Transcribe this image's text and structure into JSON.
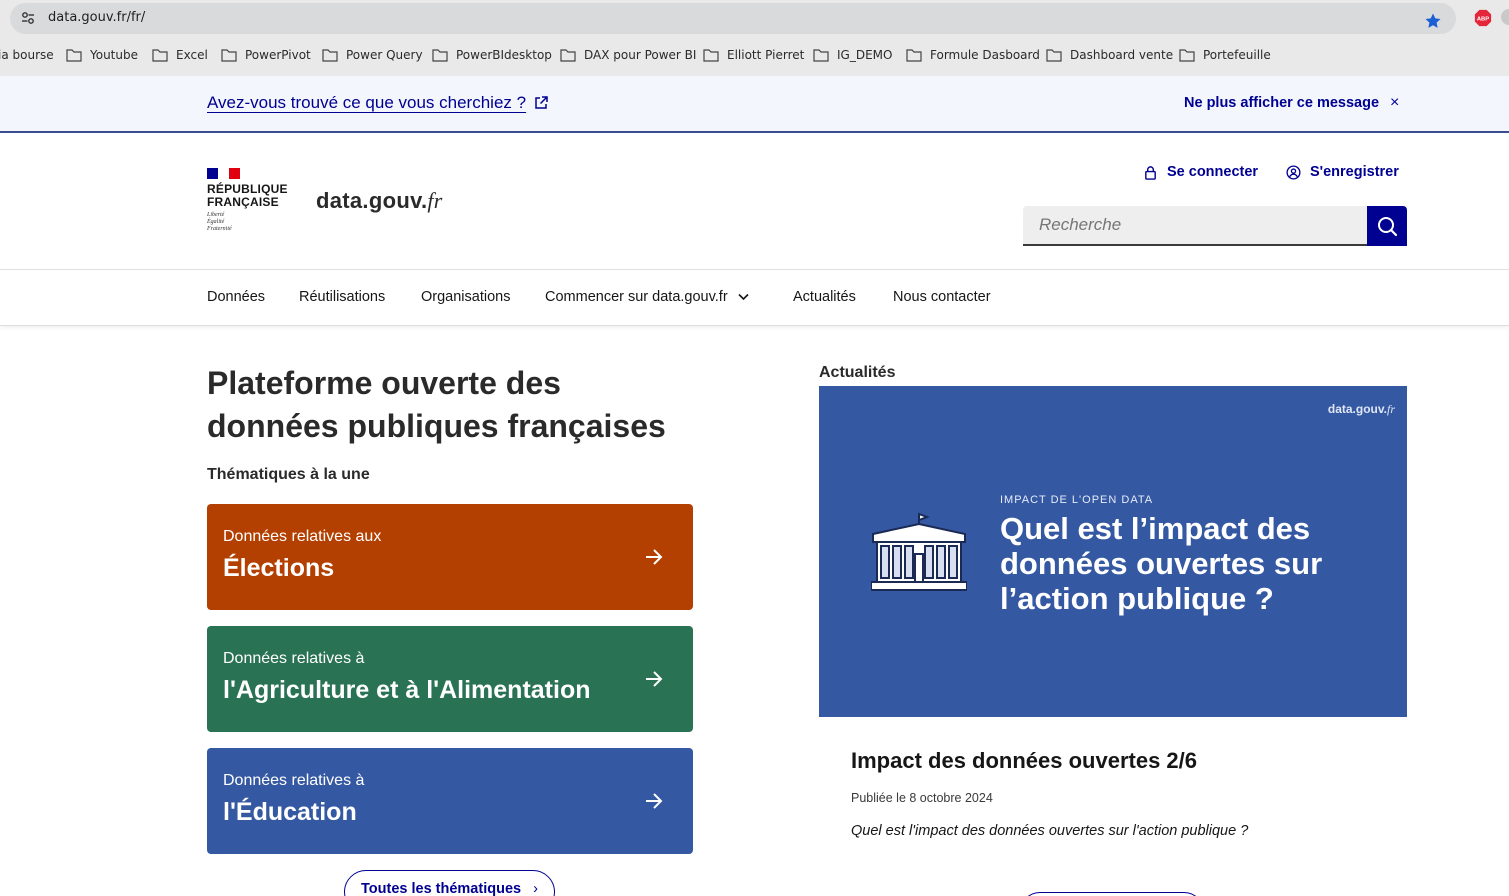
{
  "browser": {
    "url": "data.gouv.fr/fr/",
    "bookmarks": [
      "ia bourse",
      "Youtube",
      "Excel",
      "PowerPivot",
      "Power Query",
      "PowerBIdesktop",
      "DAX pour Power BI",
      "Elliott Pierret",
      "IG_DEMO",
      "Formule Dasboard",
      "Dashboard vente",
      "Portefeuille"
    ],
    "extension_label": "ABP"
  },
  "notice": {
    "link_text": "Avez-vous trouvé ce que vous cherchiez ?",
    "dismiss_text": "Ne plus afficher ce message",
    "dismiss_icon": "×"
  },
  "header": {
    "rf_name_line1": "RÉPUBLIQUE",
    "rf_name_line2": "FRANÇAISE",
    "rf_motto": [
      "Liberté",
      "Égalité",
      "Fraternité"
    ],
    "site_title_main": "data.gouv.",
    "site_title_suffix": "fr",
    "login_label": "Se connecter",
    "register_label": "S'enregistrer",
    "search_placeholder": "Recherche"
  },
  "nav": {
    "items": [
      "Données",
      "Réutilisations",
      "Organisations",
      "Commencer sur data.gouv.fr",
      "Actualités",
      "Nous contacter"
    ]
  },
  "main": {
    "title_line1": "Plateforme ouverte des",
    "title_line2": "données publiques françaises",
    "themes_heading": "Thématiques à la une",
    "themes": [
      {
        "small": "Données relatives aux",
        "big": "Élections",
        "color": "#b34000"
      },
      {
        "small": "Données relatives à",
        "big": "l'Agriculture et à l'Alimentation",
        "color": "#297254"
      },
      {
        "small": "Données relatives à",
        "big": "l'Éducation",
        "color": "#3558a2"
      }
    ],
    "all_themes_label": "Toutes les thématiques",
    "all_themes_icon": "›"
  },
  "news": {
    "heading": "Actualités",
    "image": {
      "brand_main": "data.gouv.",
      "brand_suffix": "fr",
      "kicker": "IMPACT DE L'OPEN DATA",
      "headline": "Quel est l’impact des données ouvertes sur l’action publique ?"
    },
    "title": "Impact des données ouvertes 2/6",
    "date": "Publiée le 8 octobre 2024",
    "description": "Quel est l'impact des données ouvertes sur l'action publique ?"
  },
  "colors": {
    "primary": "#000091",
    "notice_bg": "#f3f6fd",
    "elections": "#b34000",
    "agriculture": "#297254",
    "education": "#3558a2"
  }
}
